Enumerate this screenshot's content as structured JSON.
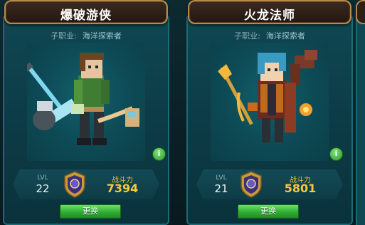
{
  "cards": [
    {
      "title": "爆破游侠",
      "subclass_label": "子职业:",
      "subclass_value": "海洋探索者",
      "info_icon": "i",
      "lvl_label": "LVL",
      "level": "22",
      "power_label": "战斗力",
      "power": "7394",
      "swap_label": "更换"
    },
    {
      "title": "火龙法师",
      "subclass_label": "子职业:",
      "subclass_value": "海洋探索者",
      "info_icon": "i",
      "lvl_label": "LVL",
      "level": "21",
      "power_label": "战斗力",
      "power": "5801",
      "swap_label": "更换"
    }
  ],
  "colors": {
    "panel": "#0f4752",
    "title_border": "#b88a4a",
    "power_gold": "#f5c93e",
    "button_green": "#2fae33"
  },
  "icons": [
    "info-icon",
    "rank-badge-icon"
  ]
}
